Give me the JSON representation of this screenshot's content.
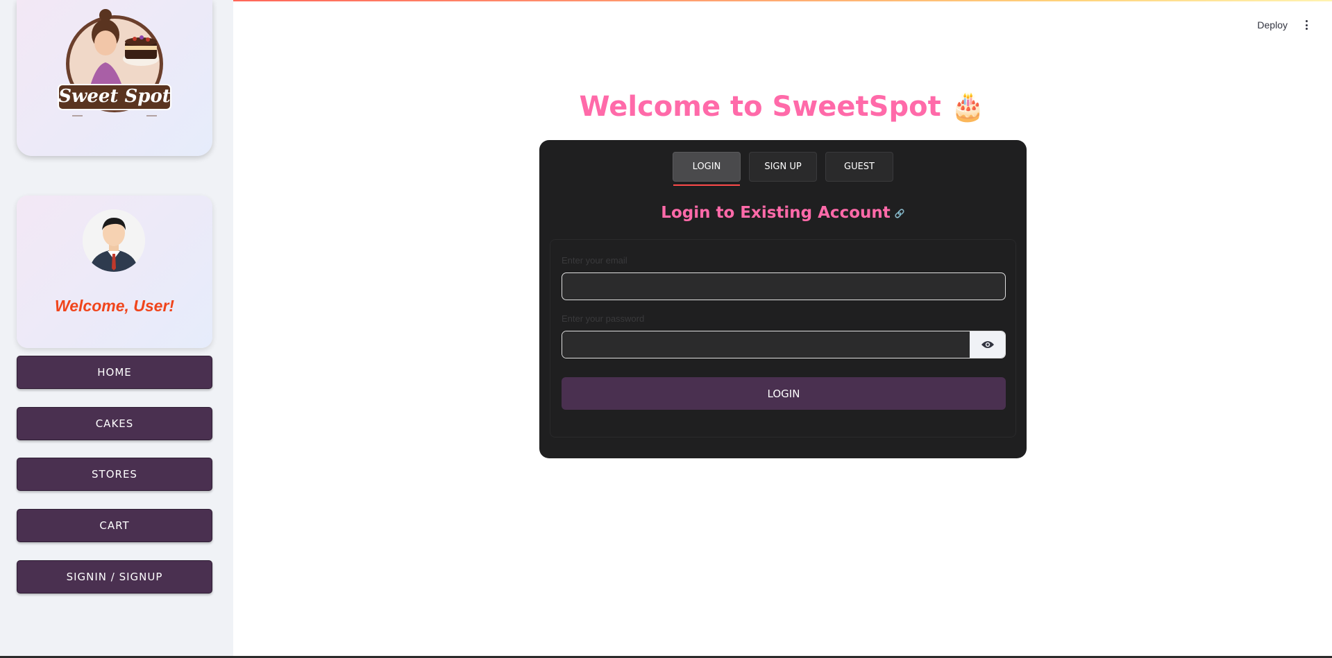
{
  "sidebar": {
    "logo_text": "Sweet Spot",
    "welcome": "Welcome, User!",
    "nav": [
      {
        "label": "HOME"
      },
      {
        "label": "CAKES"
      },
      {
        "label": "STORES"
      },
      {
        "label": "CART"
      },
      {
        "label": "SIGNIN / SIGNUP"
      }
    ]
  },
  "header": {
    "deploy_label": "Deploy",
    "menu_icon": "kebab-menu-icon"
  },
  "main": {
    "title": "Welcome to SweetSpot 🎂",
    "tabs": [
      {
        "label": "LOGIN",
        "active": true
      },
      {
        "label": "SIGN UP",
        "active": false
      },
      {
        "label": "GUEST",
        "active": false
      }
    ],
    "heading": "Login to Existing Account",
    "email": {
      "label": "Enter your email",
      "value": "",
      "placeholder": ""
    },
    "password": {
      "label": "Enter your password",
      "value": "",
      "placeholder": ""
    },
    "show_password_icon": "eye-icon",
    "submit_label": "LOGIN"
  },
  "colors": {
    "accent_pink": "#ff6aa9",
    "nav_button": "#4a3050",
    "panel_bg": "#1f1f20",
    "welcome_orange": "#f0451c"
  }
}
